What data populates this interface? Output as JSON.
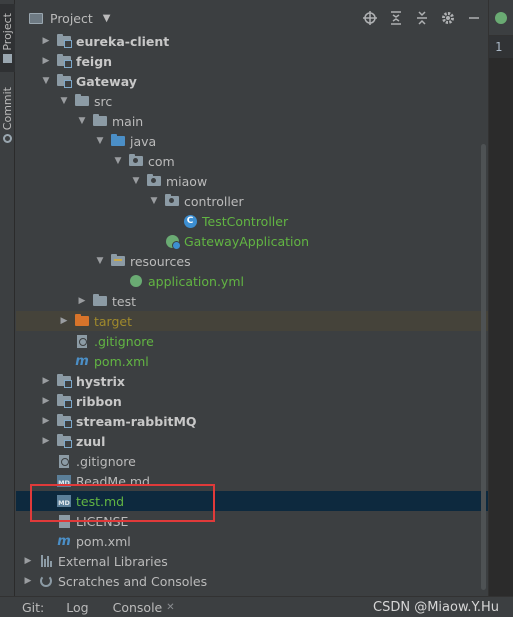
{
  "left_strip": {
    "project_tab": "Project",
    "commit_tab": "Commit"
  },
  "header": {
    "title": "Project"
  },
  "tree": [
    {
      "label": "eureka-client",
      "level": 1,
      "expanded": false,
      "icon": "module-folder-icon",
      "style": "bold"
    },
    {
      "label": "feign",
      "level": 1,
      "expanded": false,
      "icon": "module-folder-icon",
      "style": "bold"
    },
    {
      "label": "Gateway",
      "level": 1,
      "expanded": true,
      "icon": "module-folder-icon",
      "style": "bold"
    },
    {
      "label": "src",
      "level": 2,
      "expanded": true,
      "icon": "folder-icon",
      "style": "normal"
    },
    {
      "label": "main",
      "level": 3,
      "expanded": true,
      "icon": "folder-icon",
      "style": "normal"
    },
    {
      "label": "java",
      "level": 4,
      "expanded": true,
      "icon": "source-folder-icon",
      "style": "normal"
    },
    {
      "label": "com",
      "level": 5,
      "expanded": true,
      "icon": "package-icon",
      "style": "normal"
    },
    {
      "label": "miaow",
      "level": 6,
      "expanded": true,
      "icon": "package-icon",
      "style": "normal"
    },
    {
      "label": "controller",
      "level": 7,
      "expanded": true,
      "icon": "package-icon",
      "style": "normal"
    },
    {
      "label": "TestController",
      "level": 8,
      "expanded": null,
      "icon": "class-icon",
      "style": "green"
    },
    {
      "label": "GatewayApplication",
      "level": 7,
      "expanded": null,
      "icon": "spring-boot-class-icon",
      "style": "green"
    },
    {
      "label": "resources",
      "level": 4,
      "expanded": true,
      "icon": "resources-folder-icon",
      "style": "normal"
    },
    {
      "label": "application.yml",
      "level": 5,
      "expanded": null,
      "icon": "yaml-file-icon",
      "style": "green"
    },
    {
      "label": "test",
      "level": 3,
      "expanded": false,
      "icon": "folder-icon",
      "style": "normal"
    },
    {
      "label": "target",
      "level": 2,
      "expanded": false,
      "icon": "excluded-folder-icon",
      "style": "yellow",
      "highlight": true
    },
    {
      "label": ".gitignore",
      "level": 2,
      "expanded": null,
      "icon": "gitignore-file-icon",
      "style": "green"
    },
    {
      "label": "pom.xml",
      "level": 2,
      "expanded": null,
      "icon": "maven-icon",
      "style": "green"
    },
    {
      "label": "hystrix",
      "level": 1,
      "expanded": false,
      "icon": "module-folder-icon",
      "style": "bold"
    },
    {
      "label": "ribbon",
      "level": 1,
      "expanded": false,
      "icon": "module-folder-icon",
      "style": "bold"
    },
    {
      "label": "stream-rabbitMQ",
      "level": 1,
      "expanded": false,
      "icon": "module-folder-icon",
      "style": "bold"
    },
    {
      "label": "zuul",
      "level": 1,
      "expanded": false,
      "icon": "module-folder-icon",
      "style": "bold"
    },
    {
      "label": ".gitignore",
      "level": 1,
      "expanded": null,
      "icon": "gitignore-file-icon",
      "style": "normal"
    },
    {
      "label": "ReadMe.md",
      "level": 1,
      "expanded": null,
      "icon": "markdown-file-icon",
      "style": "normal"
    },
    {
      "label": "test.md",
      "level": 1,
      "expanded": null,
      "icon": "markdown-file-icon",
      "style": "green",
      "selected": true
    },
    {
      "label": "LICENSE",
      "level": 1,
      "expanded": null,
      "icon": "license-file-icon",
      "style": "normal"
    },
    {
      "label": "pom.xml",
      "level": 1,
      "expanded": null,
      "icon": "maven-icon",
      "style": "normal"
    },
    {
      "label": "External Libraries",
      "level": 0,
      "expanded": false,
      "icon": "libraries-icon",
      "style": "normal"
    },
    {
      "label": "Scratches and Consoles",
      "level": 0,
      "expanded": false,
      "icon": "scratches-icon",
      "style": "normal"
    }
  ],
  "editor": {
    "line_number": "1"
  },
  "bottom": {
    "git": "Git:",
    "log": "Log",
    "console": "Console"
  },
  "watermark": "CSDN @Miaow.Y.Hu",
  "colors": {
    "accent_green": "#62b543",
    "selection": "#0d293e",
    "highlight_box": "#e03a3a"
  }
}
